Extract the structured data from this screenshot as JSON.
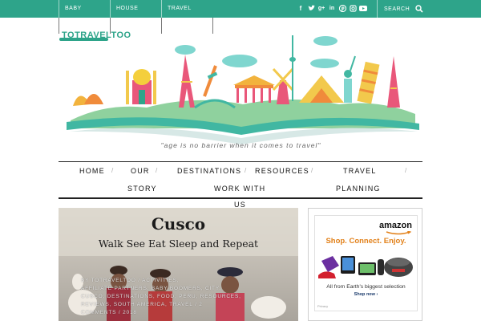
{
  "colors": {
    "accent": "#2ea48a",
    "text": "#111111",
    "amazon_orange": "#e2811a"
  },
  "topbar": {
    "nav": [
      "BABY",
      "HOUSE",
      "TRAVEL"
    ],
    "social_icons": [
      "facebook-icon",
      "twitter-icon",
      "google-plus-icon",
      "linkedin-icon",
      "pinterest-icon",
      "instagram-icon",
      "youtube-icon"
    ],
    "search_label": "SEARCH"
  },
  "logo": {
    "text": "TOTRAVELTOO"
  },
  "tagline": "\"age is no barrier when it comes to travel\"",
  "mainnav": {
    "items": [
      "HOME",
      "OUR",
      "DESTINATIONS",
      "RESOURCES",
      "TRAVEL",
      "STORY",
      "WORK WITH",
      "PLANNING",
      "US"
    ]
  },
  "hero": {
    "title": "Cusco",
    "subtitle": "Walk See Eat Sleep and Repeat",
    "meta_line1": "BY TOTRAVELTOO / ACTIVITIES,",
    "meta_line2": "AFFILIATE PARTNERS, BABY BOOMERS, CITY,",
    "meta_line3": "CUSCO, DESTINATIONS, FOOD, PERU, RESOURCES,",
    "meta_line4": "REVIEWS, SOUTH AMERICA, TRAVEL / 2",
    "meta_line5": "COMMENTS / 2018"
  },
  "sidebar_ad": {
    "brand": "amazon",
    "slogan": "Shop. Connect. Enjoy.",
    "caption": "All from Earth's biggest selection",
    "shop_now": "Shop now ›",
    "privacy": "Privacy"
  }
}
